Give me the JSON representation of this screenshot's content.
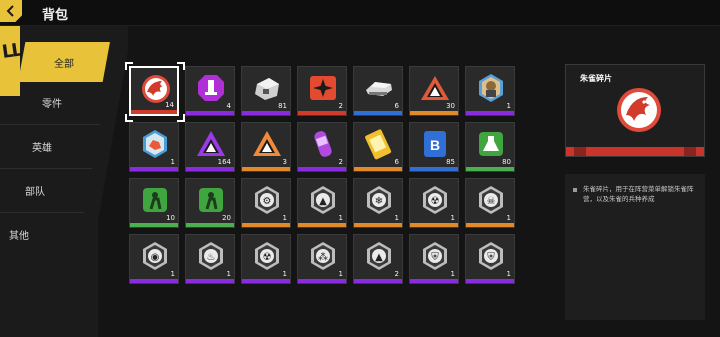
{
  "header": {
    "title": "背包"
  },
  "sidebar": {
    "deco_text": "LLS",
    "tabs": [
      {
        "label": "全部",
        "active": true
      },
      {
        "label": "零件",
        "active": false
      },
      {
        "label": "英雄",
        "active": false
      },
      {
        "label": "部队",
        "active": false
      },
      {
        "label": "其他",
        "active": false
      }
    ]
  },
  "colors": {
    "accent": "#e8c33a",
    "rarity_red": "#d23a2c",
    "rarity_purple": "#8a2be2",
    "rarity_blue": "#2f6fd6",
    "rarity_orange": "#e08a2a",
    "rarity_green": "#4caf50",
    "rarity_white": "#e0e0e0"
  },
  "inventory": {
    "rows": [
      [
        {
          "icon": "phoenix-shard-icon",
          "count": "14",
          "rarity": "red",
          "selected": true
        },
        {
          "icon": "purple-octagon-part-icon",
          "count": "4",
          "rarity": "purple"
        },
        {
          "icon": "mech-crate-icon",
          "count": "81",
          "rarity": "purple"
        },
        {
          "icon": "red-star-badge-icon",
          "count": "2",
          "rarity": "red"
        },
        {
          "icon": "tank-chassis-icon",
          "count": "6",
          "rarity": "blue"
        },
        {
          "icon": "red-chevron-insignia-icon",
          "count": "30",
          "rarity": "orange"
        },
        {
          "icon": "soldier-portrait-icon",
          "count": "1",
          "rarity": "purple"
        }
      ],
      [
        {
          "icon": "blue-hex-card-icon",
          "count": "1",
          "rarity": "purple"
        },
        {
          "icon": "purple-triangle-insignia-icon",
          "count": "164",
          "rarity": "purple"
        },
        {
          "icon": "orange-triangle-insignia-icon",
          "count": "3",
          "rarity": "orange"
        },
        {
          "icon": "purple-capsule-icon",
          "count": "2",
          "rarity": "purple"
        },
        {
          "icon": "gold-ticket-icon",
          "count": "6",
          "rarity": "orange"
        },
        {
          "icon": "blue-badge-icon",
          "count": "85",
          "rarity": "blue"
        },
        {
          "icon": "green-flask-icon",
          "count": "80",
          "rarity": "green"
        }
      ],
      [
        {
          "icon": "green-soldier-card-icon",
          "count": "10",
          "rarity": "green"
        },
        {
          "icon": "green-runner-card-icon",
          "count": "20",
          "rarity": "green"
        },
        {
          "icon": "gear-token-icon",
          "count": "1",
          "rarity": "orange"
        },
        {
          "icon": "tri-token-icon",
          "count": "1",
          "rarity": "orange"
        },
        {
          "icon": "snowflake-token-icon",
          "count": "1",
          "rarity": "orange"
        },
        {
          "icon": "radiation-token-icon",
          "count": "1",
          "rarity": "orange"
        },
        {
          "icon": "skull-token-icon",
          "count": "1",
          "rarity": "orange"
        }
      ],
      [
        {
          "icon": "globe-token-icon",
          "count": "1",
          "rarity": "purple"
        },
        {
          "icon": "flame-token-icon",
          "count": "1",
          "rarity": "purple"
        },
        {
          "icon": "radiation-token-icon",
          "count": "1",
          "rarity": "purple"
        },
        {
          "icon": "dots-token-icon",
          "count": "1",
          "rarity": "purple"
        },
        {
          "icon": "tri-token-icon",
          "count": "2",
          "rarity": "purple"
        },
        {
          "icon": "shield-token-icon",
          "count": "1",
          "rarity": "purple"
        },
        {
          "icon": "shield-token-icon",
          "count": "1",
          "rarity": "purple"
        }
      ]
    ]
  },
  "detail": {
    "title": "朱雀碎片",
    "icon": "phoenix-shard-icon",
    "rarity": "red",
    "description": "朱雀碎片，用于在阵营菜单解锁朱雀阵营，以及朱雀的兵种养成"
  }
}
